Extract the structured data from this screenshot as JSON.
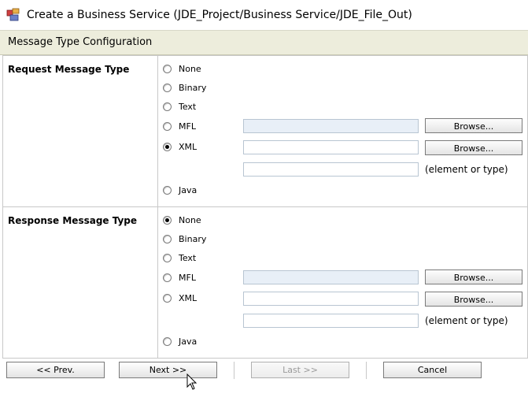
{
  "window": {
    "title": "Create a Business Service (JDE_Project/Business Service/JDE_File_Out)",
    "icon": "business-service-icon"
  },
  "header": {
    "title": "Message Type Configuration",
    "band_color": "#ededdc"
  },
  "request": {
    "label": "Request Message Type",
    "options": [
      "None",
      "Binary",
      "Text",
      "MFL",
      "XML",
      "Java"
    ],
    "selected": "XML",
    "browse_label": "Browse...",
    "hint": "(element or type)"
  },
  "response": {
    "label": "Response Message Type",
    "options": [
      "None",
      "Binary",
      "Text",
      "MFL",
      "XML",
      "Java"
    ],
    "selected": "None",
    "browse_label": "Browse...",
    "hint": "(element or type)"
  },
  "nav": {
    "prev": "<< Prev.",
    "next": "Next >>",
    "last": "Last >>",
    "cancel": "Cancel"
  }
}
